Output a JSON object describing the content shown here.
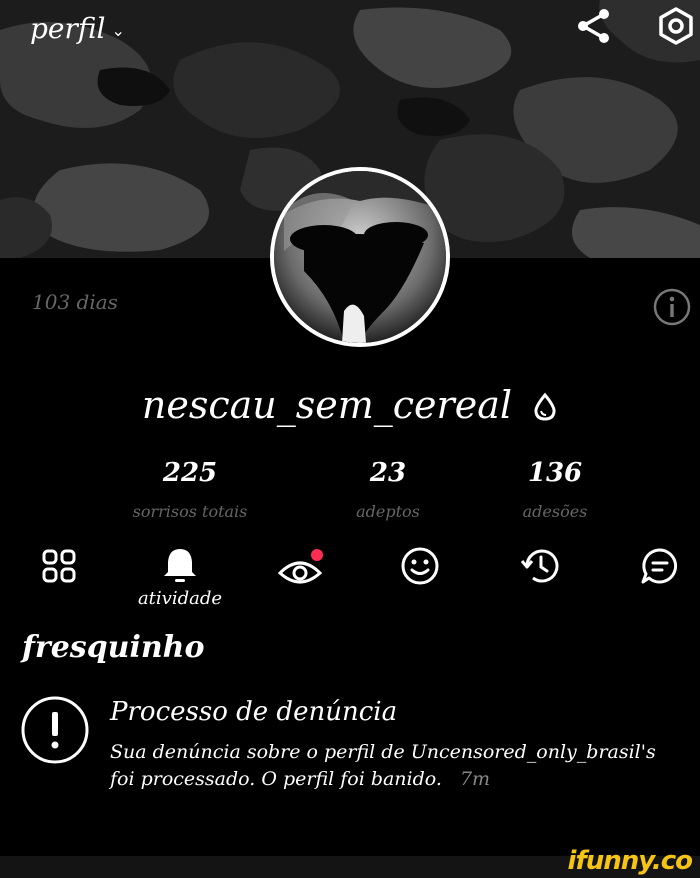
{
  "header": {
    "title": "perfil",
    "title_chevron": "chevron-down-icon",
    "share_icon": "share-icon",
    "settings_icon": "settings-hexagon-icon"
  },
  "profile": {
    "days": "103 dias",
    "username": "nescau_sem_cereal",
    "badge_icon": "drop-icon",
    "stats": [
      {
        "value": "225",
        "label": "sorrisos totais"
      },
      {
        "value": "23",
        "label": "adeptos"
      },
      {
        "value": "136",
        "label": "adesões"
      }
    ]
  },
  "tabs": [
    {
      "name": "grid",
      "icon": "grid-icon",
      "label": ""
    },
    {
      "name": "activity",
      "icon": "bell-icon",
      "label": "atividade",
      "active": true
    },
    {
      "name": "watching",
      "icon": "eye-icon",
      "label": "",
      "notification_dot": true
    },
    {
      "name": "smiles",
      "icon": "smiley-icon",
      "label": ""
    },
    {
      "name": "history",
      "icon": "history-icon",
      "label": ""
    },
    {
      "name": "chat",
      "icon": "chat-icon",
      "label": ""
    }
  ],
  "feed": {
    "section_title": "fresquinho",
    "notification": {
      "icon": "alert-icon",
      "title": "Processo de denúncia",
      "body": "Sua denúncia sobre o perfil de Uncensored_only_brasil's foi processado. O perfil foi banido.",
      "time": "7m"
    }
  },
  "watermark": "ifunny.co",
  "colors": {
    "background": "#000000",
    "text": "#ffffff",
    "muted": "#666666",
    "notification_dot": "#ff2d55",
    "watermark": "#f6c413"
  }
}
